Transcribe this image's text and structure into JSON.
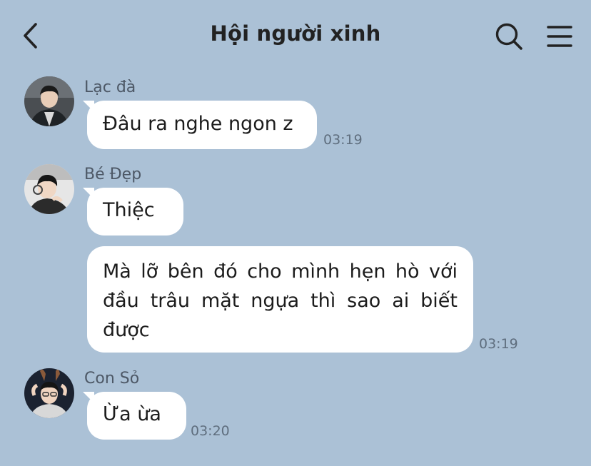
{
  "header": {
    "title": "Hội người xinh",
    "back_icon": "chevron-left-icon",
    "search_icon": "search-icon",
    "menu_icon": "hamburger-menu-icon"
  },
  "messages": [
    {
      "sender": "Lạc đà",
      "text": "Đâu ra nghe ngon z",
      "time": "03:19"
    },
    {
      "sender": "Bé Đẹp",
      "text": "Thiệc"
    },
    {
      "text": "Mà lỡ bên đó cho mình hẹn hò với đầu trâu mặt ngựa thì sao ai biết được",
      "time": "03:19"
    },
    {
      "sender": "Con Sỏ",
      "text": "Ừa ừa",
      "time": "03:20"
    }
  ],
  "colors": {
    "background": "#abc1d6",
    "bubble": "#ffffff",
    "sender_text": "#4d5866",
    "time_text": "#5f6e7e"
  }
}
